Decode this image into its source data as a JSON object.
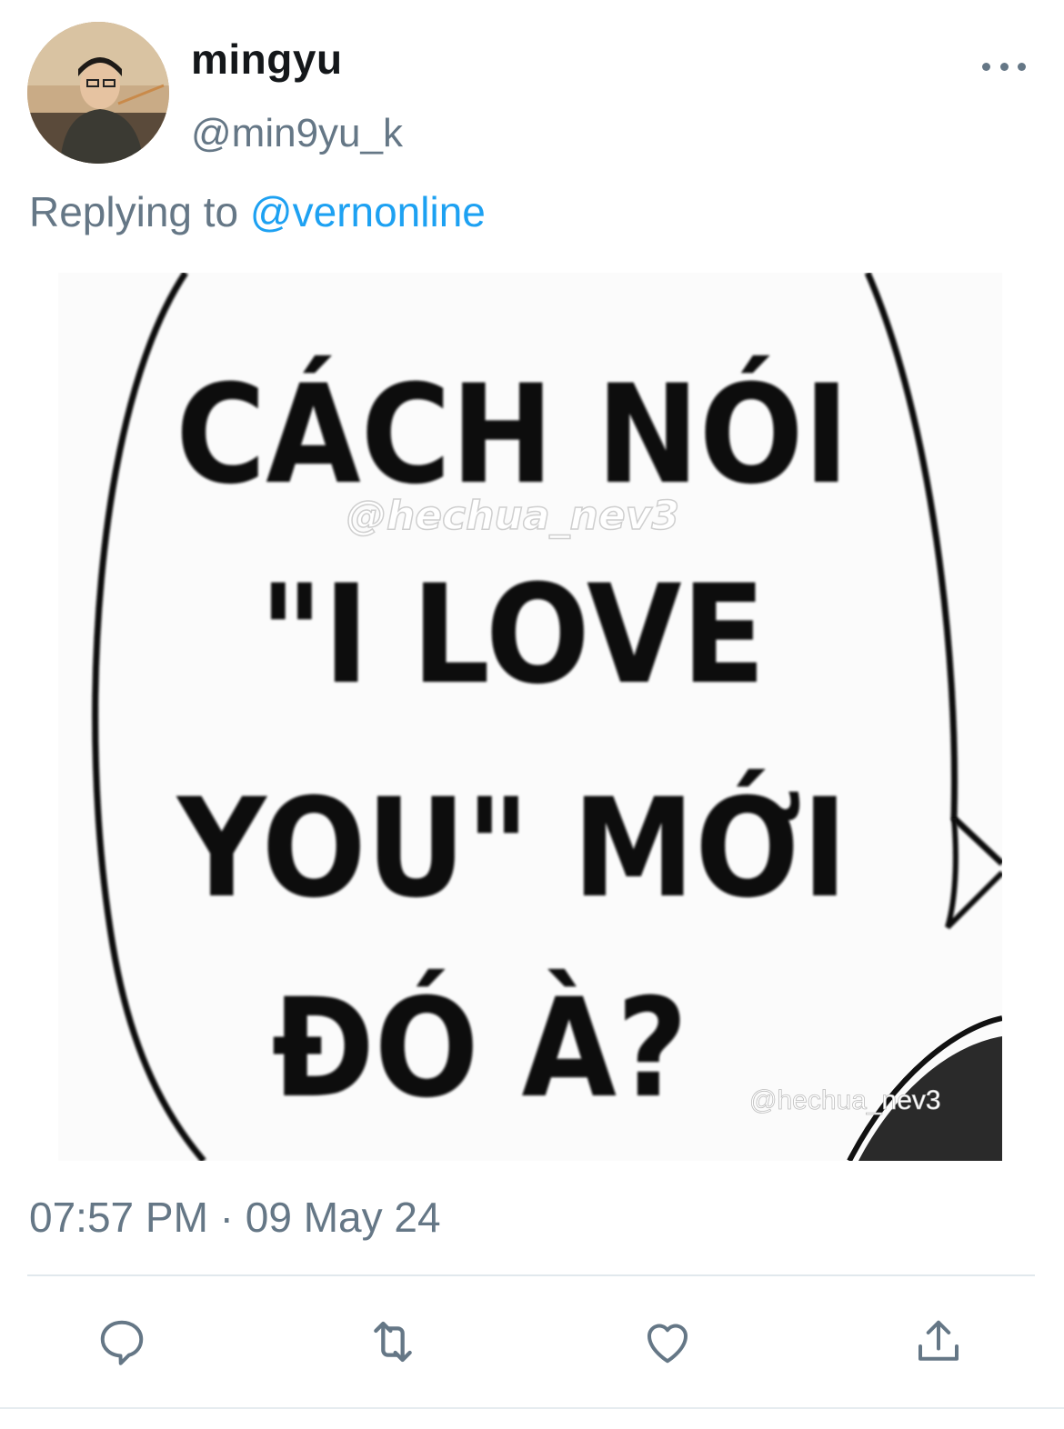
{
  "tweet": {
    "display_name": "mingyu",
    "handle": "@min9yu_k",
    "reply_prefix": "Replying to",
    "reply_to": "@vernonline",
    "timestamp": "07:57 PM · 09 May 24"
  },
  "media": {
    "lines": [
      "CÁCH NÓI",
      "\"I LOVE",
      "YOU\" MỚI",
      "ĐÓ À?"
    ],
    "watermark_center": "@hechua_nev3",
    "watermark_corner": "@hechua_nev3"
  },
  "actions": {
    "reply_icon": "reply-icon",
    "retweet_icon": "retweet-icon",
    "like_icon": "heart-icon",
    "share_icon": "share-icon"
  },
  "colors": {
    "text_primary": "#14171a",
    "text_secondary": "#657786",
    "link": "#1da1f2",
    "divider": "#e1e8ed"
  }
}
